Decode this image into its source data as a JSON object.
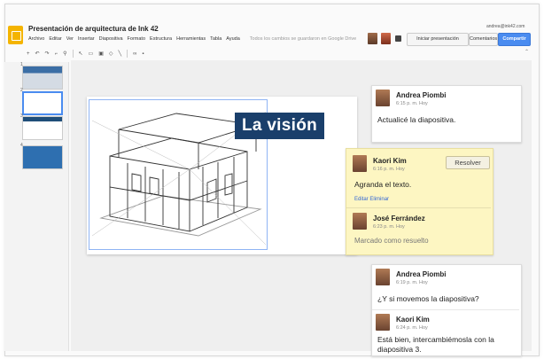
{
  "app": {
    "doc_title": "Presentación de arquitectura de Ink 42",
    "doc_status": "",
    "account_email": "andrea@ink42.com",
    "menu": [
      "Archivo",
      "Editar",
      "Ver",
      "Insertar",
      "Diapositiva",
      "Formato",
      "Estructura",
      "Herramientas",
      "Tabla",
      "Ayuda"
    ],
    "save_note": "Todos los cambios se guardaron en Google Drive",
    "present_label": "Iniciar presentación",
    "comments_label": "Comentarios",
    "share_label": "Compartir"
  },
  "toolbar": {
    "icons": [
      "add-slide-icon",
      "undo-icon",
      "redo-icon",
      "paint-format-icon",
      "zoom-icon",
      "select-icon",
      "textbox-icon",
      "image-icon",
      "shape-icon",
      "line-icon",
      "link-icon",
      "comment-add-icon"
    ]
  },
  "filmstrip": {
    "numbers": [
      "1",
      "2",
      "3",
      "4"
    ]
  },
  "slide": {
    "title": "La visión"
  },
  "comments": {
    "c1": {
      "author": "Andrea Piombi",
      "time": "6:15 p. m. Hoy",
      "text": "Actualicé la diapositiva."
    },
    "c2": {
      "author": "Kaori Kim",
      "time": "6:16 p. m. Hoy",
      "text": "Agranda el texto.",
      "resolve_label": "Resolver",
      "edit_label": "Editar",
      "delete_label": "Eliminar",
      "reply_author": "José Ferrández",
      "reply_time": "6:23 p. m. Hoy",
      "reply_text": "Marcado como resuelto"
    },
    "c3": {
      "author": "Andrea Piombi",
      "time": "6:19 p. m. Hoy",
      "text": "¿Y si movemos la diapositiva?",
      "reply_author": "Kaori Kim",
      "reply_time": "6:24 p. m. Hoy",
      "reply_text": "Está bien, intercambiémosla con la diapositiva 3."
    }
  },
  "colors": {
    "accent": "#4a8cf0",
    "title_bg": "#1a3f6b",
    "note_bg": "#fdf6c2",
    "logo": "#f4b400"
  }
}
